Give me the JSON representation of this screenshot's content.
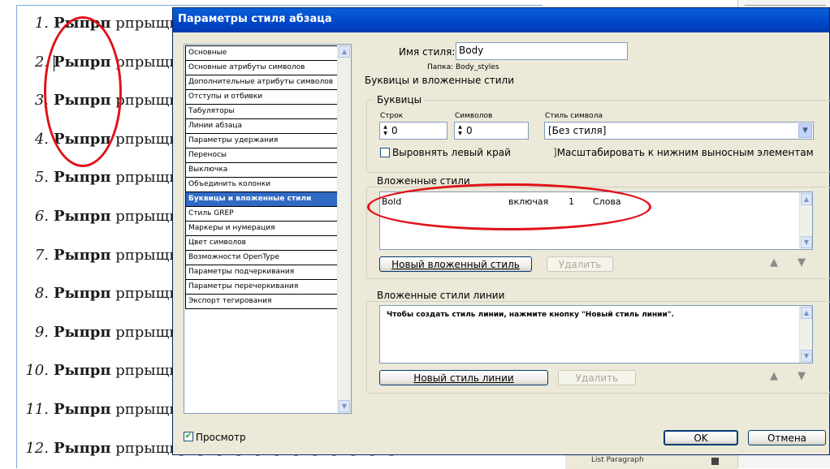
{
  "document": {
    "lines": [
      {
        "num": "1.",
        "bold": "Рыпрп",
        "rest": " рпрыщпрпрпрпрпрпрпрпрпрпрпрпрп"
      },
      {
        "num": "2.",
        "bold": "Рыпрп",
        "rest": " рпрыщпрпрпрпрпрпрпрпрпрпрпрпрп"
      },
      {
        "num": "3.",
        "bold": "Рыпрп",
        "rest": " рпрыщпрпрпрпрпрпрпрпрпрпрпрпрп"
      },
      {
        "num": "4.",
        "bold": "Рыпрп",
        "rest": " рпрыщпрпрпрпрпрпрпрпрпрпрпрпрп"
      },
      {
        "num": "5.",
        "bold": "Рыпрп",
        "rest": " рпрыщпрпрпрпрпрпрпрпрпрпрпрпрп"
      },
      {
        "num": "6.",
        "bold": "Рыпрп",
        "rest": " рпрыщпрпрпрпрпрпрпрпрпрпрпрпрп"
      },
      {
        "num": "7.",
        "bold": "Рыпрп",
        "rest": " рпрыщпрпрпрпрпрпрпрпрпрпрпрпрп"
      },
      {
        "num": "8.",
        "bold": "Рыпрп",
        "rest": " рпрыщпрпрпрпрпрпрпрпрпрпрпрпрп"
      },
      {
        "num": "9.",
        "bold": "Рыпрп",
        "rest": " рпрыщпрпрпрпрпрпрпрпрпрпрпрпрп"
      },
      {
        "num": "10.",
        "bold": "Рыпрп",
        "rest": " рпрыщпрпрпрпрпрпрпрпрпрпрпрпрп"
      },
      {
        "num": "11.",
        "bold": "Рыпрп",
        "rest": " рпрыщпрпрпрпрпрпрпрпрпрпрпрпрп"
      },
      {
        "num": "12.",
        "bold": "Рыпрп",
        "rest": " рпрыщпрпрпрпрпрпрпрпрпрпрпрпрп"
      }
    ],
    "panel_item": "List Paragraph"
  },
  "dialog": {
    "title": "Параметры стиля абзаца",
    "categories": [
      "Основные",
      "Основные атрибуты символов",
      "Дополнительные атрибуты символов",
      "Отступы и отбивки",
      "Табуляторы",
      "Линии абзаца",
      "Параметры удержания",
      "Переносы",
      "Выключка",
      "Объединить колонки",
      "Буквицы и вложенные стили",
      "Стиль GREP",
      "Маркеры и нумерация",
      "Цвет символов",
      "Возможности OpenType",
      "Параметры подчеркивания",
      "Параметры перечеркивания",
      "Экспорт тегирования"
    ],
    "selected_category": "Буквицы и вложенные стили",
    "style_name_label": "Имя стиля:",
    "style_name_value": "Body",
    "folder_label": "Папка: Body_styles",
    "section_title": "Буквицы и вложенные стили",
    "drop_caps": {
      "group_title": "Буквицы",
      "lines_label": "Строк",
      "lines_value": "0",
      "chars_label": "Символов",
      "chars_value": "0",
      "char_style_label": "Стиль символа",
      "char_style_value": "[Без стиля]",
      "align_left_label": "Выровнять левый край",
      "scale_label": "Масштабировать к нижним выносным элементам"
    },
    "nested_styles": {
      "group_title": "Вложенные стили",
      "rows": [
        {
          "style": "Bold",
          "mode": "включая",
          "count": "1",
          "unit": "Слова"
        }
      ],
      "new_button": "Новый вложенный стиль",
      "delete_button": "Удалить"
    },
    "nested_line_styles": {
      "group_title": "Вложенные стили линии",
      "hint": "Чтобы создать стиль линии, нажмите кнопку \"Новый стиль линии\".",
      "new_button": "Новый стиль линии",
      "delete_button": "Удалить"
    },
    "preview_label": "Просмотр",
    "preview_checked": true,
    "ok_button": "OK",
    "cancel_button": "Отмена"
  },
  "colors": {
    "annotation_red": "#e0121a",
    "title_blue": "#0047c8",
    "selection_blue": "#316ac5"
  }
}
